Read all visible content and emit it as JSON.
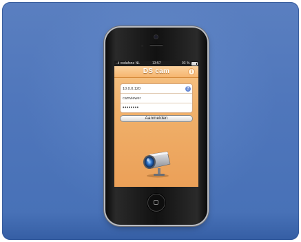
{
  "status_bar": {
    "carrier": "..ıl vodafone NL",
    "time": "13:57",
    "battery_text": "93 %"
  },
  "nav": {
    "title": "DS cam",
    "info_glyph": "i"
  },
  "login_form": {
    "host_value": "10.0.0.120",
    "username_value": "camviewer",
    "password_value": "••••••••",
    "help_glyph": "?",
    "login_label": "Aanmelden"
  },
  "icons": {
    "info": "info-icon",
    "help": "help-icon",
    "camera": "camera-icon",
    "home": "home-button-icon"
  },
  "colors": {
    "background": "#4f76bb",
    "screen_accent": "#f0b06a",
    "help_icon": "#6f8fd6"
  }
}
